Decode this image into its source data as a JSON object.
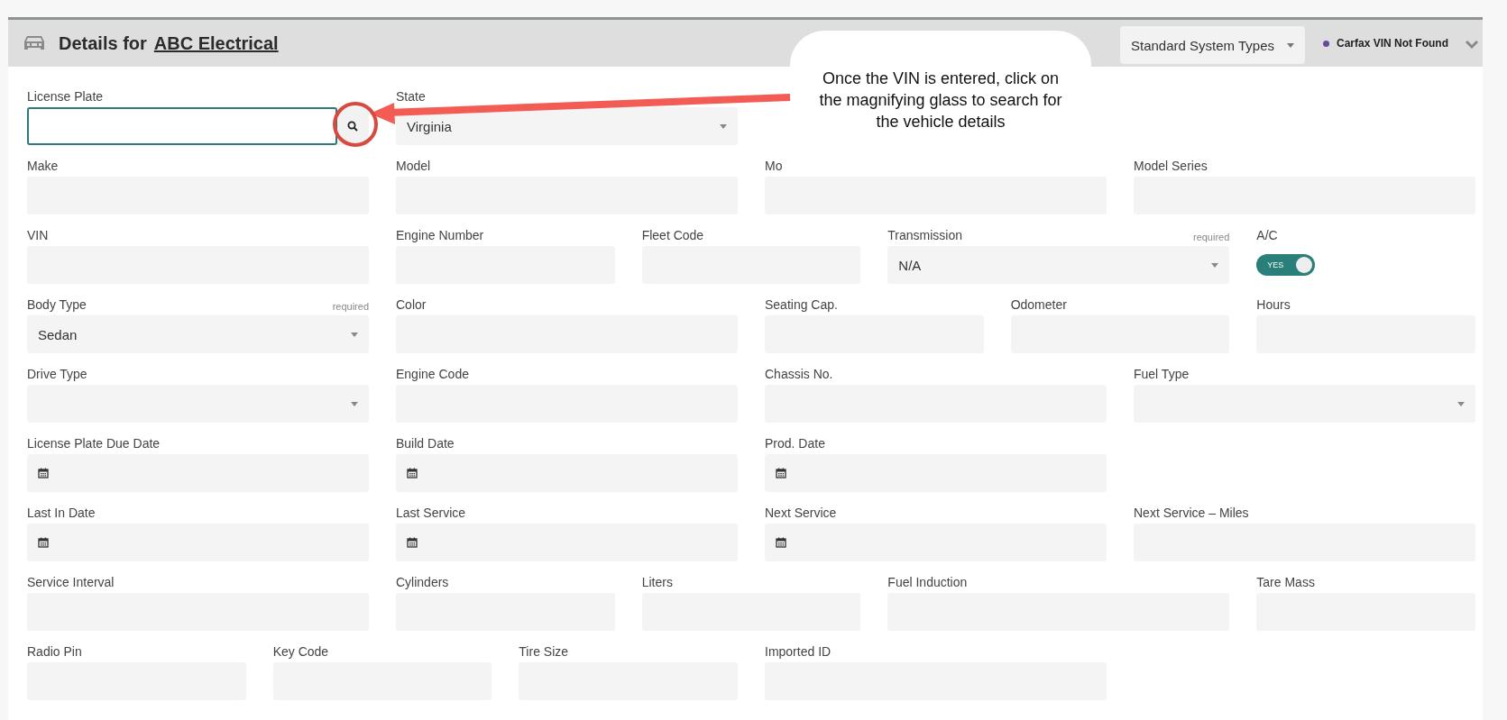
{
  "header": {
    "title": "Details for",
    "link": "ABC Electrical",
    "system_types": {
      "value": "Standard System Types"
    },
    "status": {
      "text": "Carfax VIN Not Found",
      "color": "#6a4a9c"
    }
  },
  "rows": [
    [
      {
        "label": "License Plate",
        "kind": "search",
        "focused": true
      },
      {
        "label": "State",
        "kind": "select",
        "value": "Virginia"
      }
    ],
    [
      {
        "label": "Make",
        "kind": "text"
      },
      {
        "label": "Model",
        "kind": "text"
      },
      {
        "label": "Mo",
        "kind": "text"
      },
      {
        "label": "Model Series",
        "kind": "text"
      }
    ],
    [
      {
        "label": "VIN",
        "kind": "text"
      },
      {
        "label": "Engine Number",
        "kind": "text"
      },
      {
        "label": "Fleet Code",
        "kind": "text"
      },
      {
        "label": "Transmission",
        "kind": "select",
        "value": "N/A",
        "required": "required"
      },
      {
        "label": "A/C",
        "kind": "toggle",
        "on": true,
        "toggle_text": "YES"
      }
    ],
    [
      {
        "label": "Body Type",
        "kind": "select",
        "value": "Sedan",
        "required": "required"
      },
      {
        "label": "Color",
        "kind": "text"
      },
      {
        "label": "Seating Cap.",
        "kind": "text"
      },
      {
        "label": "Odometer",
        "kind": "text"
      },
      {
        "label": "Hours",
        "kind": "text"
      }
    ],
    [
      {
        "label": "Drive Type",
        "kind": "select"
      },
      {
        "label": "Engine Code",
        "kind": "text"
      },
      {
        "label": "Chassis No.",
        "kind": "text"
      },
      {
        "label": "Fuel Type",
        "kind": "select"
      }
    ],
    [
      {
        "label": "License Plate Due Date",
        "kind": "date"
      },
      {
        "label": "Build Date",
        "kind": "date"
      },
      {
        "label": "Prod. Date",
        "kind": "date"
      }
    ],
    [
      {
        "label": "Last In Date",
        "kind": "date"
      },
      {
        "label": "Last Service",
        "kind": "date"
      },
      {
        "label": "Next Service",
        "kind": "date"
      },
      {
        "label": "Next Service – Miles",
        "kind": "text"
      }
    ],
    [
      {
        "label": "Service Interval",
        "kind": "text"
      },
      {
        "label": "Cylinders",
        "kind": "text"
      },
      {
        "label": "Liters",
        "kind": "text"
      },
      {
        "label": "Fuel Induction",
        "kind": "text"
      },
      {
        "label": "Tare Mass",
        "kind": "text"
      }
    ],
    [
      {
        "label": "Radio Pin",
        "kind": "text"
      },
      {
        "label": "Key Code",
        "kind": "text"
      },
      {
        "label": "Tire Size",
        "kind": "text"
      },
      {
        "label": "Imported ID",
        "kind": "text"
      }
    ]
  ],
  "annotation": {
    "text": "Once the VIN is entered, click on the magnifying glass to search for the vehicle details"
  }
}
